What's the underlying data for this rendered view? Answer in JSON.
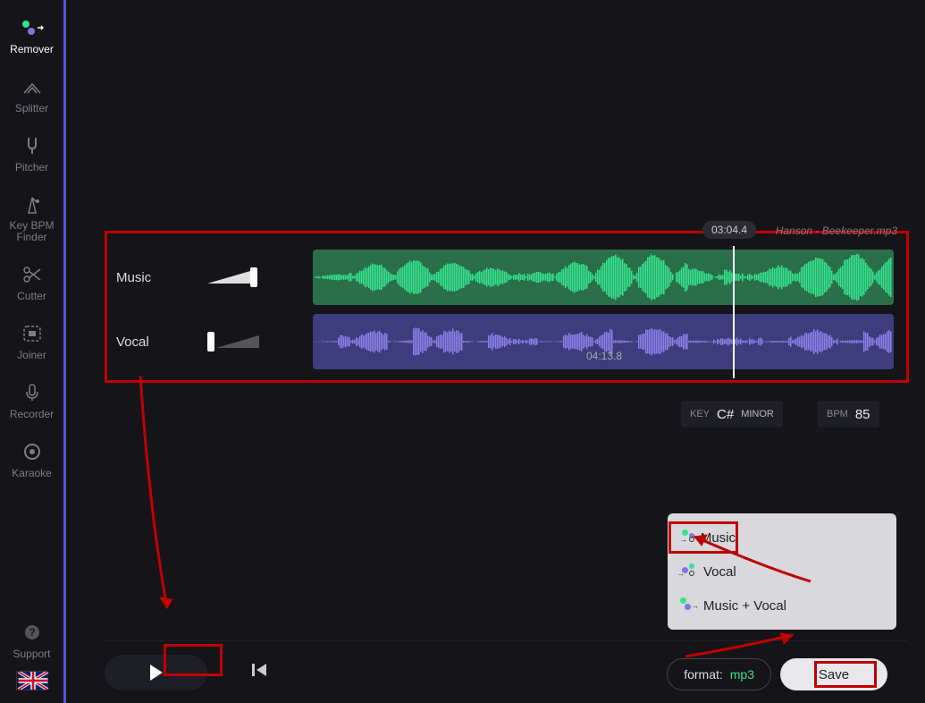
{
  "sidebar": {
    "items": [
      {
        "label": "Remover"
      },
      {
        "label": "Splitter"
      },
      {
        "label": "Pitcher"
      },
      {
        "label": "Key BPM Finder"
      },
      {
        "label": "Cutter"
      },
      {
        "label": "Joiner"
      },
      {
        "label": "Recorder"
      },
      {
        "label": "Karaoke"
      }
    ],
    "support_label": "Support"
  },
  "tracks": {
    "music_label": "Music",
    "vocal_label": "Vocal",
    "playhead_time": "03:04.4",
    "duration": "04:13.8",
    "filename": "Hanson - Beekeeper.mp3"
  },
  "key_info": {
    "label": "KEY",
    "note": "C#",
    "mode": "MINOR"
  },
  "bpm_info": {
    "label": "BPM",
    "value": "85"
  },
  "save_menu": {
    "options": [
      {
        "label": "Music"
      },
      {
        "label": "Vocal"
      },
      {
        "label": "Music + Vocal"
      }
    ]
  },
  "bottom": {
    "format_label": "format:",
    "format_value": "mp3",
    "save_label": "Save"
  }
}
